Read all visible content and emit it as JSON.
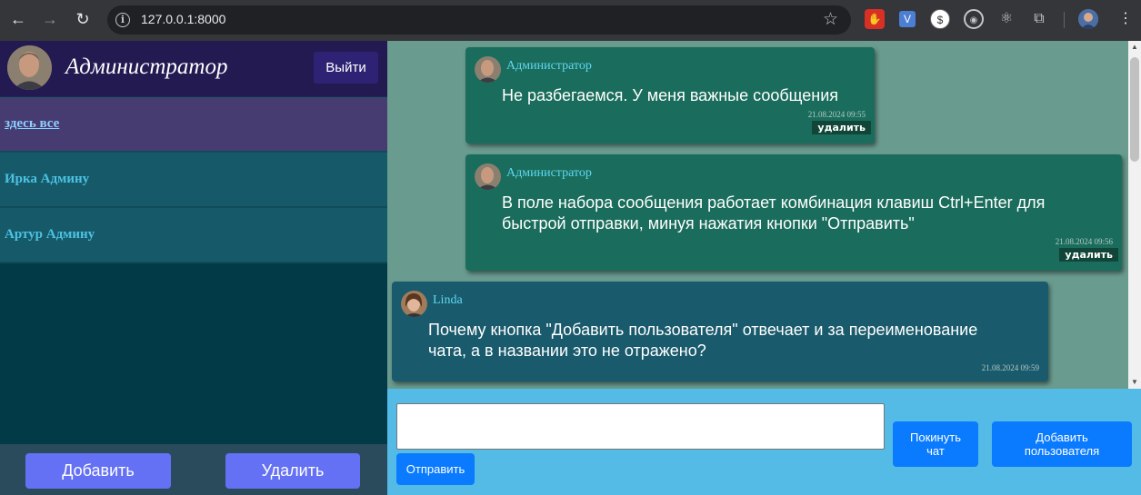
{
  "browser": {
    "url": "127.0.0.1:8000",
    "icons": [
      "back-arrow-icon",
      "forward-arrow-icon",
      "reload-icon",
      "site-info-icon",
      "bookmark-star-icon",
      "extensions-puzzle-icon"
    ]
  },
  "sidebar": {
    "user_name": "Администратор",
    "logout_label": "Выйти",
    "chats": [
      {
        "label": "здесь все",
        "active": true
      },
      {
        "label": "Ирка Админу",
        "active": false
      },
      {
        "label": "Артур Админу",
        "active": false
      }
    ],
    "add_label": "Добавить",
    "delete_label": "Удалить"
  },
  "messages": [
    {
      "author": "Администратор",
      "text_lines": [
        "Не разбегаемся. У меня важные сообщения"
      ],
      "time": "21.08.2024 09:55",
      "delete_label": "удалить"
    },
    {
      "author": "Администратор",
      "text_lines": [
        "В поле набора сообщения работает комбинация клавиш Ctrl+Enter для",
        "быстрой отправки, минуя нажатия кнопки \"Отправить\""
      ],
      "time": "21.08.2024 09:56",
      "delete_label": "удалить"
    },
    {
      "author": "Linda",
      "text_lines": [
        "Почему кнопка \"Добавить пользователя\" отвечает и за переименование",
        "чата, а в названии это не отражено?"
      ],
      "time": "21.08.2024 09:59"
    }
  ],
  "composer": {
    "input_value": "",
    "send_label": "Отправить",
    "leave_label_lines": [
      "Покинуть",
      "чат"
    ],
    "add_user_label_lines": [
      "Добавить",
      "пользователя"
    ]
  },
  "colors": {
    "admin_bubble": "#1a6d5c",
    "linda_bubble": "#195a6c",
    "accent_blue": "#0a7bff",
    "sidebar_button": "#6471f5"
  }
}
